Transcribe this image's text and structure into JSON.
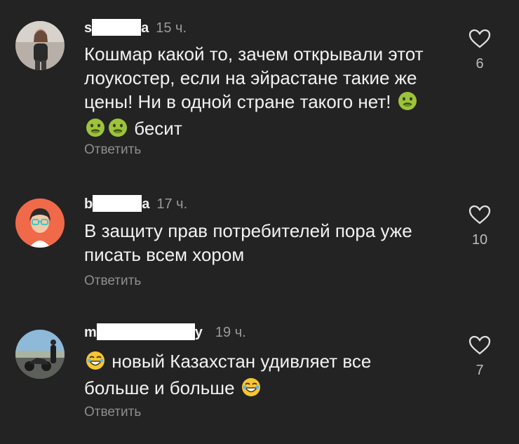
{
  "comments": [
    {
      "user_start": "s",
      "user_end": "a",
      "time": "15 ч.",
      "text_1": "Кошмар какой то, зачем открывали этот",
      "text_2": "лоукостер, если на эйрастане такие же",
      "text_3": "цены! Ни в одной стране такого нет!",
      "text_4": "бесит",
      "reply": "Ответить",
      "likes": "6",
      "emoji": "nauseated-face"
    },
    {
      "user_start": "b",
      "user_end": "a",
      "time": "17 ч.",
      "text_1": "В защиту прав потребителей пора уже",
      "text_2": "писать всем хором",
      "reply": "Ответить",
      "likes": "10"
    },
    {
      "user_start": "m",
      "user_end": "y",
      "time": "19 ч.",
      "text_1": "новый Казахстан удивляет все",
      "text_2": "больше и больше",
      "reply": "Ответить",
      "likes": "7",
      "emoji": "laughing-face"
    }
  ],
  "colors": {
    "background": "#232323",
    "text": "#f2f2f2",
    "muted": "#8e8e8e"
  }
}
